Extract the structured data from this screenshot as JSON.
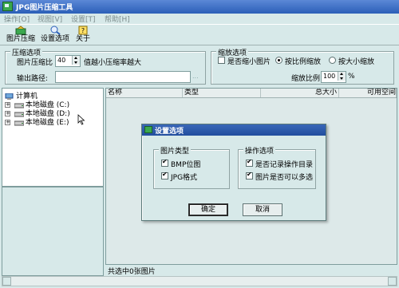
{
  "window": {
    "title": "JPG图片压缩工具"
  },
  "menu": {
    "items": [
      "操作[O]",
      "视图[V]",
      "设置[T]",
      "帮助[H]"
    ]
  },
  "toolbar": {
    "buttons": [
      "图片压缩",
      "设置选项",
      "关于"
    ]
  },
  "compress_options": {
    "group_title": "压缩选项",
    "ratio_label": "图片压缩比",
    "ratio_value": "40",
    "ratio_hint": "值越小压缩率越大",
    "output_label": "输出路径:",
    "output_value": "",
    "browse_label": "..."
  },
  "scale_options": {
    "group_title": "缩放选项",
    "shrink_label": "是否缩小图片",
    "proportional_label": "按比例缩放",
    "size_label": "按大小缩放",
    "scale_ratio_label": "缩放比例",
    "scale_ratio_value": "100",
    "percent_sign": "%",
    "shrink_checked": false,
    "proportional_selected": true
  },
  "tree": {
    "root": "计算机",
    "drives": [
      "本地磁盘 (C:)",
      "本地磁盘 (D:)",
      "本地磁盘 (E:)"
    ]
  },
  "list": {
    "columns": [
      "名称",
      "类型",
      "总大小",
      "可用空间"
    ]
  },
  "status": {
    "text": "共选中0张图片"
  },
  "dialog": {
    "title": "设置选项",
    "image_types": {
      "group_title": "图片类型",
      "items": [
        {
          "label": "BMP位图",
          "checked": true
        },
        {
          "label": "JPG格式",
          "checked": true
        }
      ]
    },
    "operation_options": {
      "group_title": "操作选项",
      "items": [
        {
          "label": "是否记录操作目录",
          "checked": true
        },
        {
          "label": "图片是否可以多选",
          "checked": true
        }
      ]
    },
    "ok_label": "确定",
    "cancel_label": "取消"
  },
  "colors": {
    "background": "#d7e9e9",
    "title_bar": "#2b5fb8",
    "dialog_title": "#224e9e"
  }
}
